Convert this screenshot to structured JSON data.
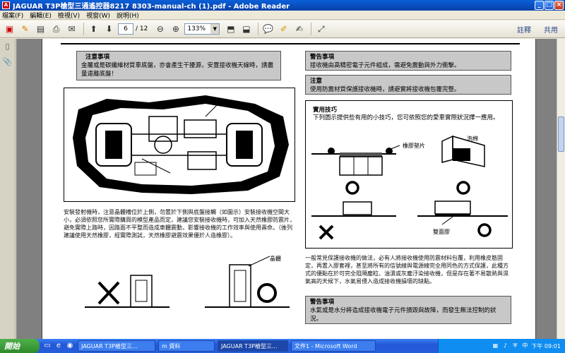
{
  "window": {
    "title": "JAGUAR T3P槍型三通遙控器8217 8303-manual-ch (1).pdf - Adobe Reader",
    "buttons": [
      "_",
      "□",
      "×"
    ]
  },
  "menu": [
    "檔案(F)",
    "編輯(E)",
    "檢視(V)",
    "視窗(W)",
    "說明(H)"
  ],
  "toolbar": {
    "page_current": "6",
    "page_total": "/ 12",
    "zoom": "133%",
    "right_links": [
      "註釋",
      "共用"
    ]
  },
  "document": {
    "notice_left": {
      "title": "注意事項",
      "body": "金屬或是碳纖維材質車底盤，亦會產生干擾源，安置接收機天線時，請盡量遠離底盤！"
    },
    "notice_warning": {
      "title": "警告事項",
      "body": "接收機由高精密電子元件組成，需避免震動與外力衝擊。"
    },
    "notice_caution": {
      "title": "注意",
      "body": "使用防震材質保護接收機時，請避實將接收機包覆完整。"
    },
    "tips": {
      "title": "實用技巧",
      "body": "下列圖示提供些有用的小技巧，您可依照您的愛車實際狀況擇一應用。",
      "label_rubber_pad": "橡膠墊片",
      "label_sponge": "泡棉",
      "label_double_tape": "雙面膠"
    },
    "install_para": "安裝發射機時，注意晶體槽位於上側，勿置於下側與底盤接觸（如圖示）安裝接收機空間大小，必須依照您所實際購買的模型產品而定，建議您安裝接收機時，可加入天然橡膠防震片，避免實際上路時，因路面不平整而造成車體震動，影響接收機的工作效率與使用壽命。（後列建議使用天然橡膠，經實際測試，天然橡膠避震效果優於人造橡膠）。",
    "crystal_label": "晶體",
    "body_para": "一般常見保護接收機的做法，必有人將接收機使用防震材料包覆，利用橡皮筋固定，再置入膠套裡，甚至將所有的信號線與電源線完全用同色的方式保護，此種方式的優點在於可完全阻隔塵粒、油漬或灰塵汙染接收機，但是存在著不易散熱與濕氣高的天候下，水氣易侵入造成接收機損壞的缺點。",
    "notice_bottom": {
      "title": "警告事項",
      "body": "水氣或是水分將造成接收機電子元件損毀與故障，而發生無法控制的狀況。"
    }
  },
  "taskbar": {
    "start": "開始",
    "tasks": [
      "JAGUAR T3P槍型三...",
      "m 資料",
      "JAGUAR T3P槍型三...",
      "文件1 - Microsoft Word"
    ],
    "clock": "下午 09:01"
  }
}
